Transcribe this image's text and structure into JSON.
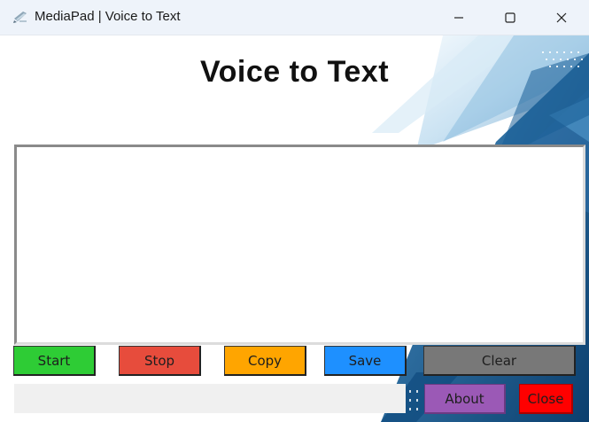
{
  "window": {
    "title": "MediaPad | Voice to Text",
    "icons": [
      "app-icon",
      "minimize-icon",
      "maximize-icon",
      "close-icon"
    ]
  },
  "header": {
    "title": "Voice to Text"
  },
  "transcript": {
    "value": ""
  },
  "buttons": {
    "start": "Start",
    "stop": "Stop",
    "copy": "Copy",
    "save": "Save",
    "clear": "Clear",
    "about": "About",
    "close": "Close"
  },
  "status": {
    "text": ""
  },
  "colors": {
    "start": "#2ecc35",
    "stop": "#e74c3c",
    "copy": "#ffa500",
    "save": "#1e90ff",
    "clear": "#787878",
    "about": "#9b59b6",
    "close": "#ff0000",
    "background_accent": "#0b4f86"
  }
}
